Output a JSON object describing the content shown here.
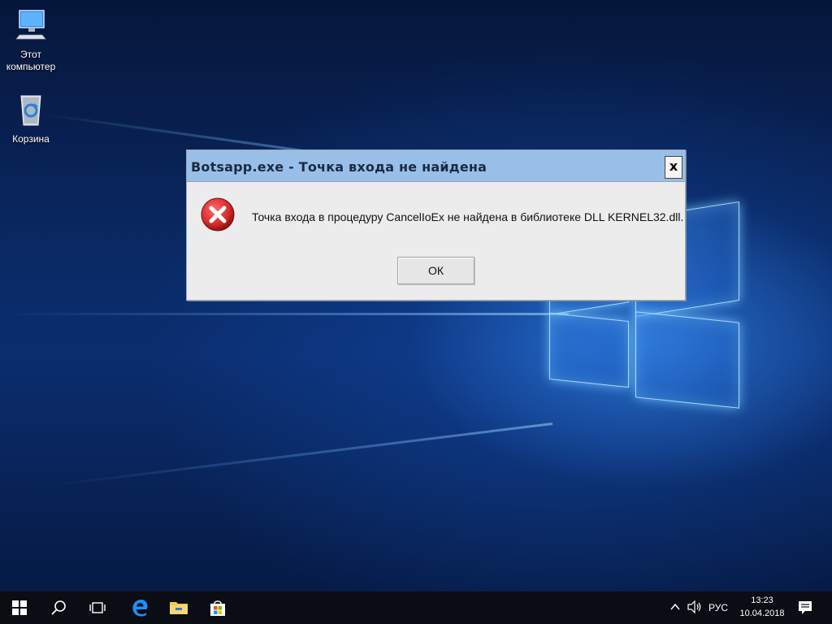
{
  "desktop": {
    "icons": [
      {
        "label_line1": "Этот",
        "label_line2": "компьютер",
        "icon": "this-pc-icon"
      },
      {
        "label_line1": "Корзина",
        "label_line2": "",
        "icon": "recycle-bin-icon"
      }
    ]
  },
  "dialog": {
    "title": "Botsapp.exe - Точка входа не найдена",
    "close_label": "x",
    "message": "Точка входа в процедуру CancelIoEx не найдена в библиотеке DLL KERNEL32.dll.",
    "ok_label": "ОК",
    "icon": "error-icon"
  },
  "taskbar": {
    "items": [
      "start-icon",
      "search-icon",
      "task-view-icon",
      "edge-icon",
      "file-explorer-icon",
      "store-icon"
    ],
    "tray": {
      "language": "РУС",
      "time": "13:23",
      "date": "10.04.2018",
      "icons": [
        "chevron-up-icon",
        "volume-icon",
        "notifications-icon"
      ]
    }
  },
  "colors": {
    "titlebar": "#99bfe8",
    "dialog_bg": "#ececec",
    "taskbar_bg": "#0b0d14",
    "error_red": "#d42a2a"
  }
}
